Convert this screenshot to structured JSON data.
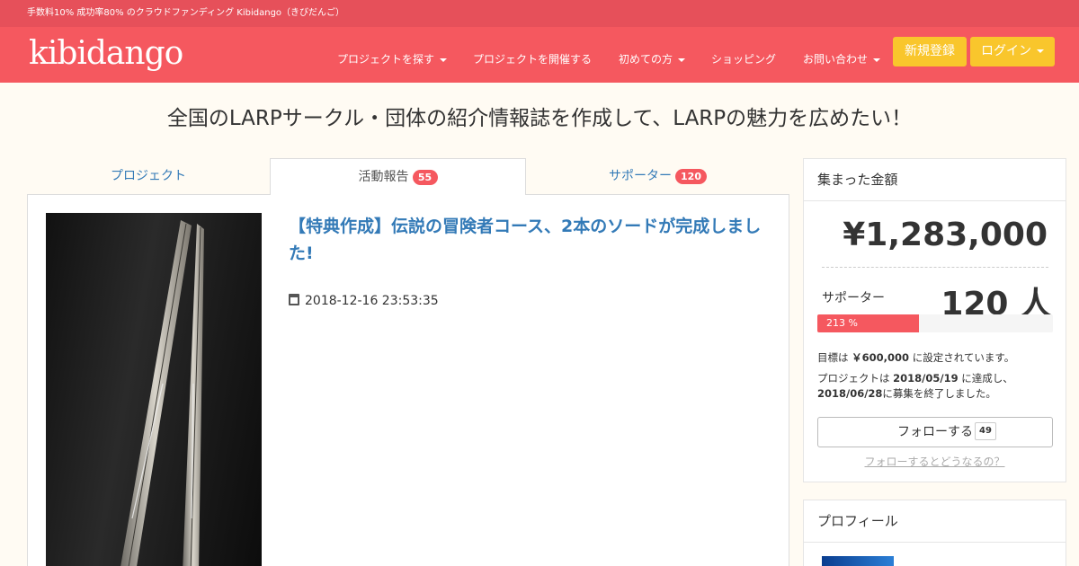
{
  "topbar": {
    "text": "手数料10% 成功率80% のクラウドファンディング Kibidango（きびだんご）"
  },
  "navbar": {
    "logo": "kibidango",
    "items": [
      {
        "label": "プロジェクトを探す",
        "dropdown": true
      },
      {
        "label": "プロジェクトを開催する",
        "dropdown": false
      },
      {
        "label": "初めての方",
        "dropdown": true
      },
      {
        "label": "ショッピング",
        "dropdown": false
      },
      {
        "label": "お問い合わせ",
        "dropdown": true
      }
    ],
    "signup_label": "新規登録",
    "login_label": "ログイン"
  },
  "page": {
    "title": "全国のLARPサークル・団体の紹介情報誌を作成して、LARPの魅力を広めたい！"
  },
  "tabs": [
    {
      "label": "プロジェクト",
      "badge": ""
    },
    {
      "label": "活動報告",
      "badge": "55"
    },
    {
      "label": "サポーター",
      "badge": "120"
    }
  ],
  "article": {
    "title": "【特典作成】伝説の冒険者コース、2本のソードが完成しました!",
    "date": "2018-12-16 23:53:35"
  },
  "sidebar": {
    "heading": "集まった金額",
    "amount": "¥1,283,000",
    "supporter_label": "サポーター",
    "supporter_count": "120 人",
    "progress_text": "213 %",
    "progress_fraction": 0.43,
    "goal_prefix": "目標は ",
    "goal_amount": "￥600,000",
    "goal_suffix": " に設定されています。",
    "achieved_prefix": "プロジェクトは ",
    "achieved_date": "2018/05/19",
    "achieved_suffix": " に達成し、",
    "end_date": "2018/06/28",
    "end_suffix": "に募集を終了しました。",
    "follow_label": "フォローする",
    "follow_count": "49",
    "follow_help": "フォローするとどうなるの？"
  },
  "profile": {
    "heading": "プロフィール"
  },
  "colors": {
    "brand": "#f5585f",
    "topbar": "#e6505a",
    "accent_yellow": "#f9c62c",
    "link": "#337ab7"
  }
}
